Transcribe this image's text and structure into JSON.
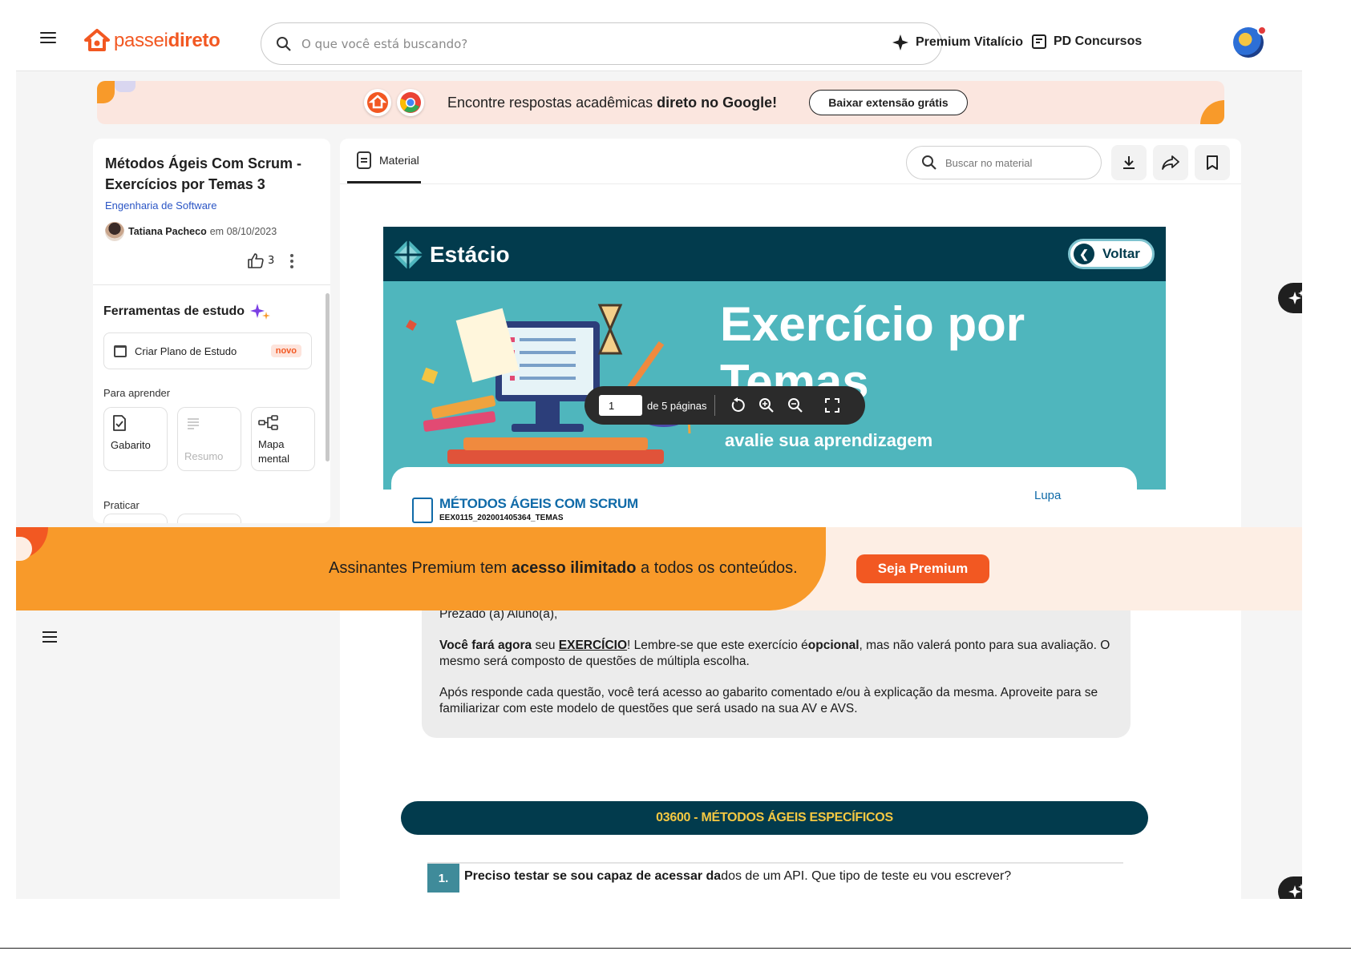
{
  "header": {
    "logo_part1": "passei",
    "logo_part2": "direto",
    "search_placeholder": "O que você está buscando?",
    "link_premium": "Premium Vitalício",
    "link_concursos": "PD Concursos"
  },
  "promo": {
    "text_pre": "Encontre respostas acadêmicas",
    "text_bold": "direto no Google!",
    "button": "Baixar extensão grátis"
  },
  "sidebar": {
    "doc_title": "Métodos Ágeis Com Scrum - Exercícios por Temas 3",
    "subject": "Engenharia de Software",
    "author": "Tatiana Pacheco",
    "date_prefix": "em",
    "date": "08/10/2023",
    "likes": "3",
    "tools_title": "Ferramentas de estudo",
    "plan_label": "Criar Plano de Estudo",
    "plan_badge": "novo",
    "learn_label": "Para aprender",
    "tools": [
      {
        "label": "Gabarito",
        "enabled": true
      },
      {
        "label": "Resumo",
        "enabled": false
      },
      {
        "label": "Mapa mental",
        "enabled": true
      }
    ],
    "practice_label": "Praticar"
  },
  "viewer": {
    "tab_label": "Material",
    "search_placeholder": "Buscar no material"
  },
  "document": {
    "brand": "Estácio",
    "back_button": "Voltar",
    "hero_title_line1": "Exercício por",
    "hero_title_line2": "Temas",
    "hero_subtitle": "avalie sua aprendizagem",
    "course_name": "MÉTODOS ÁGEIS COM SCRUM",
    "course_code": "EEX0115_202001405364_TEMAS",
    "lupa_label": "Lupa",
    "notice_greeting": "Prezado (a) Aluno(a),",
    "notice_p1_bold": "Você fará agora",
    "notice_p1_mid": "seu",
    "notice_p1_link": "EXERCÍCIO",
    "notice_p1_rest1": "! Lembre-se que este exercício é",
    "notice_p1_opt": "opcional",
    "notice_p1_rest2": ", mas não valerá ponto para sua avaliação. O mesmo será composto de questões de múltipla escolha.",
    "notice_p2": "Após responde cada questão, você terá acesso ao gabarito comentado e/ou à explicação da mesma. Aproveite para se familiarizar com este modelo de questões que será usado na sua AV e AVS.",
    "section_title": "03600 - MÉTODOS ÁGEIS ESPECÍFICOS",
    "question_number": "1.",
    "question_bold": "Preciso testar se sou capaz de acessar da",
    "question_rest": "dos de um API. Que tipo de teste eu vou escrever?"
  },
  "page_control": {
    "current_page": "1",
    "total_label": "de 5 páginas"
  },
  "premium_banner": {
    "text_pre": "Assinantes Premium tem",
    "text_bold": "acesso ilimitado",
    "text_post": "a todos os conteúdos.",
    "button": "Seja Premium"
  },
  "colors": {
    "brand_orange": "#f25822",
    "estacio_navy": "#023b4d",
    "estacio_teal": "#4fb6bd",
    "premium_orange": "#f89a2a"
  }
}
